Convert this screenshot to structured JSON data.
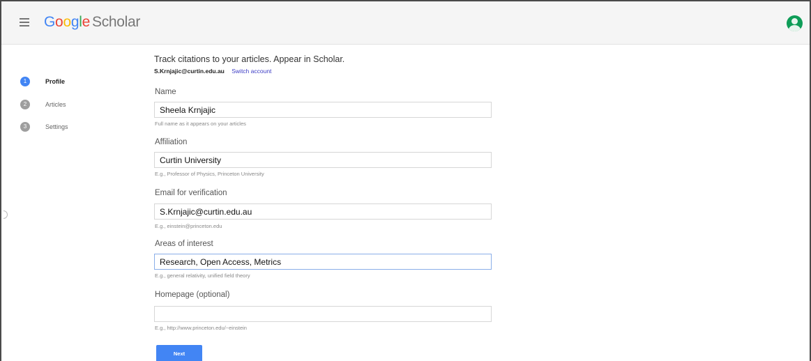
{
  "header": {
    "logo_letters": [
      "G",
      "o",
      "o",
      "g",
      "l",
      "e"
    ],
    "logo_product": "Scholar",
    "menu_icon": "hamburger-menu-icon",
    "avatar_icon": "account-avatar-icon"
  },
  "steps": [
    {
      "number": "1",
      "label": "Profile",
      "active": true
    },
    {
      "number": "2",
      "label": "Articles",
      "active": false
    },
    {
      "number": "3",
      "label": "Settings",
      "active": false
    }
  ],
  "intro": {
    "tagline": "Track citations to your articles. Appear in Scholar.",
    "account_email": "S.Krnjajic@curtin.edu.au",
    "switch_account": "Switch account"
  },
  "form": {
    "name": {
      "label": "Name",
      "value": "Sheela Krnjajic",
      "hint": "Full name as it appears on your articles"
    },
    "affiliation": {
      "label": "Affiliation",
      "value": "Curtin University",
      "hint": "E.g., Professor of Physics, Princeton University"
    },
    "email": {
      "label": "Email for verification",
      "value": "S.Krnjajic@curtin.edu.au",
      "hint": "E.g., einstein@princeton.edu"
    },
    "interests": {
      "label": "Areas of interest",
      "value": "Research, Open Access, Metrics",
      "hint": "E.g., general relativity, unified field theory"
    },
    "homepage": {
      "label": "Homepage (optional)",
      "value": "",
      "hint": "E.g., http://www.princeton.edu/~einstein"
    }
  },
  "actions": {
    "next_label": "Next"
  },
  "colors": {
    "accent": "#4285f4",
    "avatar": "#0f9d58",
    "link": "#3b3bc4"
  }
}
